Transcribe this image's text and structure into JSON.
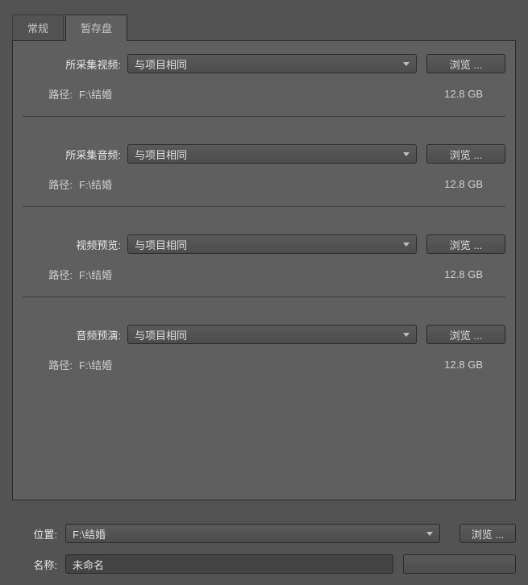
{
  "tabs": {
    "general": "常规",
    "scratch": "暂存盘"
  },
  "sections": [
    {
      "label": "所采集视频:",
      "dropdown": "与项目相同",
      "browse": "浏览 ...",
      "pathLabel": "路径:",
      "pathValue": "F:\\结婚",
      "size": "12.8 GB"
    },
    {
      "label": "所采集音频:",
      "dropdown": "与项目相同",
      "browse": "浏览 ...",
      "pathLabel": "路径:",
      "pathValue": "F:\\结婚",
      "size": "12.8 GB"
    },
    {
      "label": "视频预览:",
      "dropdown": "与项目相同",
      "browse": "浏览 ...",
      "pathLabel": "路径:",
      "pathValue": "F:\\结婚",
      "size": "12.8 GB"
    },
    {
      "label": "音频预演:",
      "dropdown": "与项目相同",
      "browse": "浏览 ...",
      "pathLabel": "路径:",
      "pathValue": "F:\\结婚",
      "size": "12.8 GB"
    }
  ],
  "bottom": {
    "locationLabel": "位置:",
    "locationValue": "F:\\结婚",
    "locationBrowse": "浏览 ...",
    "nameLabel": "名称:",
    "nameValue": "未命名"
  }
}
